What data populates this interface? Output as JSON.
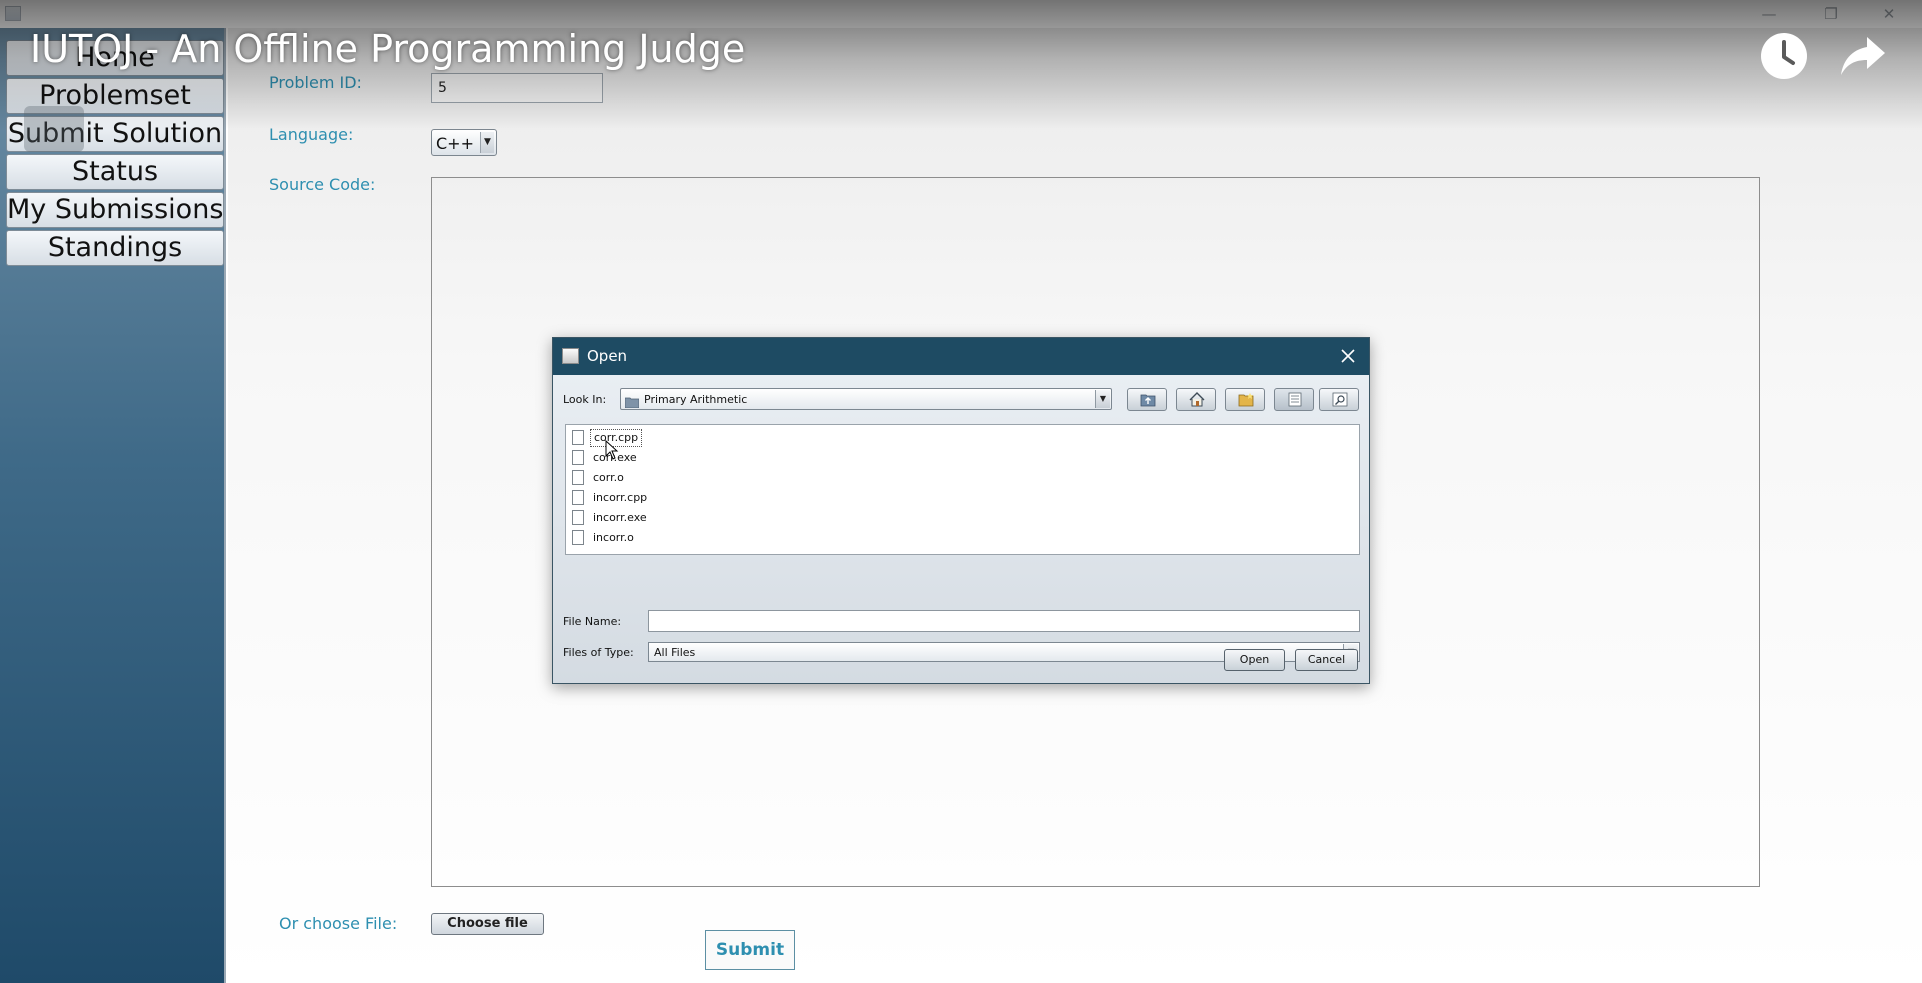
{
  "video": {
    "title": "IUTOJ - An Offline Programming Judge",
    "watch_later_icon": "clock-icon",
    "share_icon": "share-arrow-icon"
  },
  "sidebar": {
    "items": [
      {
        "label": "Home"
      },
      {
        "label": "Problemset"
      },
      {
        "label": "Submit Solution"
      },
      {
        "label": "Status"
      },
      {
        "label": "My Submissions"
      },
      {
        "label": "Standings"
      }
    ]
  },
  "form": {
    "problem_id_label": "Problem ID:",
    "problem_id_value": "5",
    "language_label": "Language:",
    "language_value": "C++",
    "source_code_label": "Source Code:",
    "choose_file_label": "Or choose File:",
    "choose_file_button": "Choose file",
    "submit_button": "Submit"
  },
  "dialog": {
    "title": "Open",
    "look_in_label": "Look In:",
    "look_in_value": "Primary Arithmetic",
    "toolbar_icons": [
      "up-folder-icon",
      "home-icon",
      "new-folder-icon",
      "list-view-icon",
      "details-view-icon"
    ],
    "files": [
      "corr.cpp",
      "corr.exe",
      "corr.o",
      "incorr.cpp",
      "incorr.exe",
      "incorr.o"
    ],
    "selected_file": "corr.cpp",
    "file_name_label": "File Name:",
    "file_name_value": "",
    "files_of_type_label": "Files of Type:",
    "files_of_type_value": "All Files",
    "open_button": "Open",
    "cancel_button": "Cancel"
  },
  "colors": {
    "label_accent": "#2e8fb0",
    "dialog_titlebar": "#1e4b63",
    "sidebar_dark": "#1f4a69"
  }
}
